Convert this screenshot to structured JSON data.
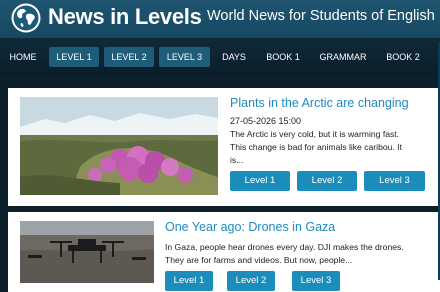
{
  "header": {
    "brand": "News in Levels",
    "tagline": "World News for Students of English"
  },
  "nav": {
    "items": [
      "HOME",
      "LEVEL 1",
      "LEVEL 2",
      "LEVEL 3",
      "DAYS",
      "BOOK 1",
      "GRAMMAR",
      "BOOK 2"
    ]
  },
  "articles": [
    {
      "title": "Plants in the Arctic are changing",
      "date": "27-05-2026 15:00",
      "excerpt_lines": [
        "The Arctic is very cold, but it is warming fast.",
        "This change is bad for animals like caribou. It",
        "is..."
      ],
      "levels": [
        "Level 1",
        "Level 2",
        "Level 3"
      ]
    },
    {
      "title": "One Year ago: Drones in Gaza",
      "excerpt_lines": [
        "In Gaza, people hear drones every day. DJI makes the drones.",
        "They are for farms and videos. But now, people..."
      ],
      "levels": [
        "Level 1",
        "Level 2",
        "Level 3"
      ]
    }
  ],
  "colors": {
    "header_bg": "#1a4d68",
    "nav_bg": "#0f2636",
    "accent": "#1b8dbb",
    "title_link": "#1f8ac0"
  }
}
